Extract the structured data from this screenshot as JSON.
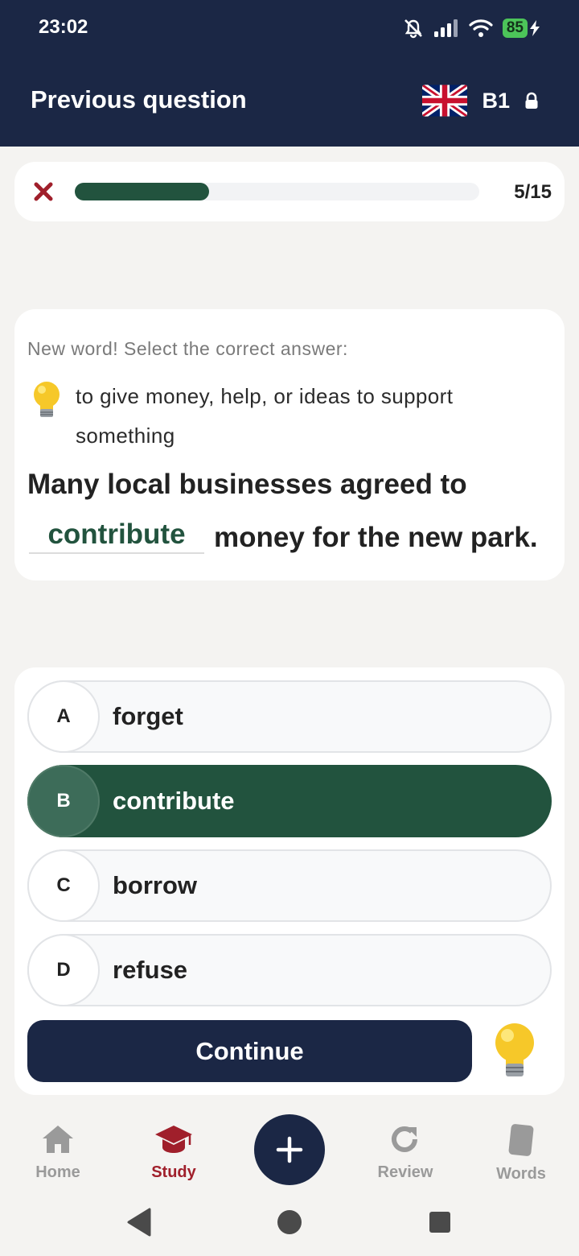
{
  "status_bar": {
    "time": "23:02",
    "battery": "85",
    "icons": [
      "mute-icon",
      "signal-icon",
      "wifi-icon",
      "battery-icon",
      "charging-icon"
    ]
  },
  "header": {
    "title": "Previous question",
    "flag": "uk-flag-icon",
    "level": "B1",
    "lock_icon": "lock-icon"
  },
  "progress": {
    "current": 5,
    "total": 15,
    "label": "5/15",
    "fraction": 0.333
  },
  "question": {
    "prompt": "New word! Select the correct answer:",
    "definition": "to give money, help, or ideas to support something",
    "sentence_before": "Many local businesses agreed to",
    "answer": "contribute",
    "sentence_after": "money for the new park."
  },
  "options": [
    {
      "letter": "A",
      "text": "forget",
      "selected": false
    },
    {
      "letter": "B",
      "text": "contribute",
      "selected": true
    },
    {
      "letter": "C",
      "text": "borrow",
      "selected": false
    },
    {
      "letter": "D",
      "text": "refuse",
      "selected": false
    }
  ],
  "continue_label": "Continue",
  "nav": {
    "items": [
      {
        "label": "Home",
        "icon": "home-icon"
      },
      {
        "label": "Study",
        "icon": "graduation-cap-icon",
        "active": true
      },
      {
        "label": "Review",
        "icon": "refresh-icon"
      },
      {
        "label": "Words",
        "icon": "card-icon"
      }
    ]
  },
  "colors": {
    "header": "#1b2745",
    "accent_green": "#22533e",
    "active_red": "#a01f2b",
    "background": "#f4f3f1"
  }
}
